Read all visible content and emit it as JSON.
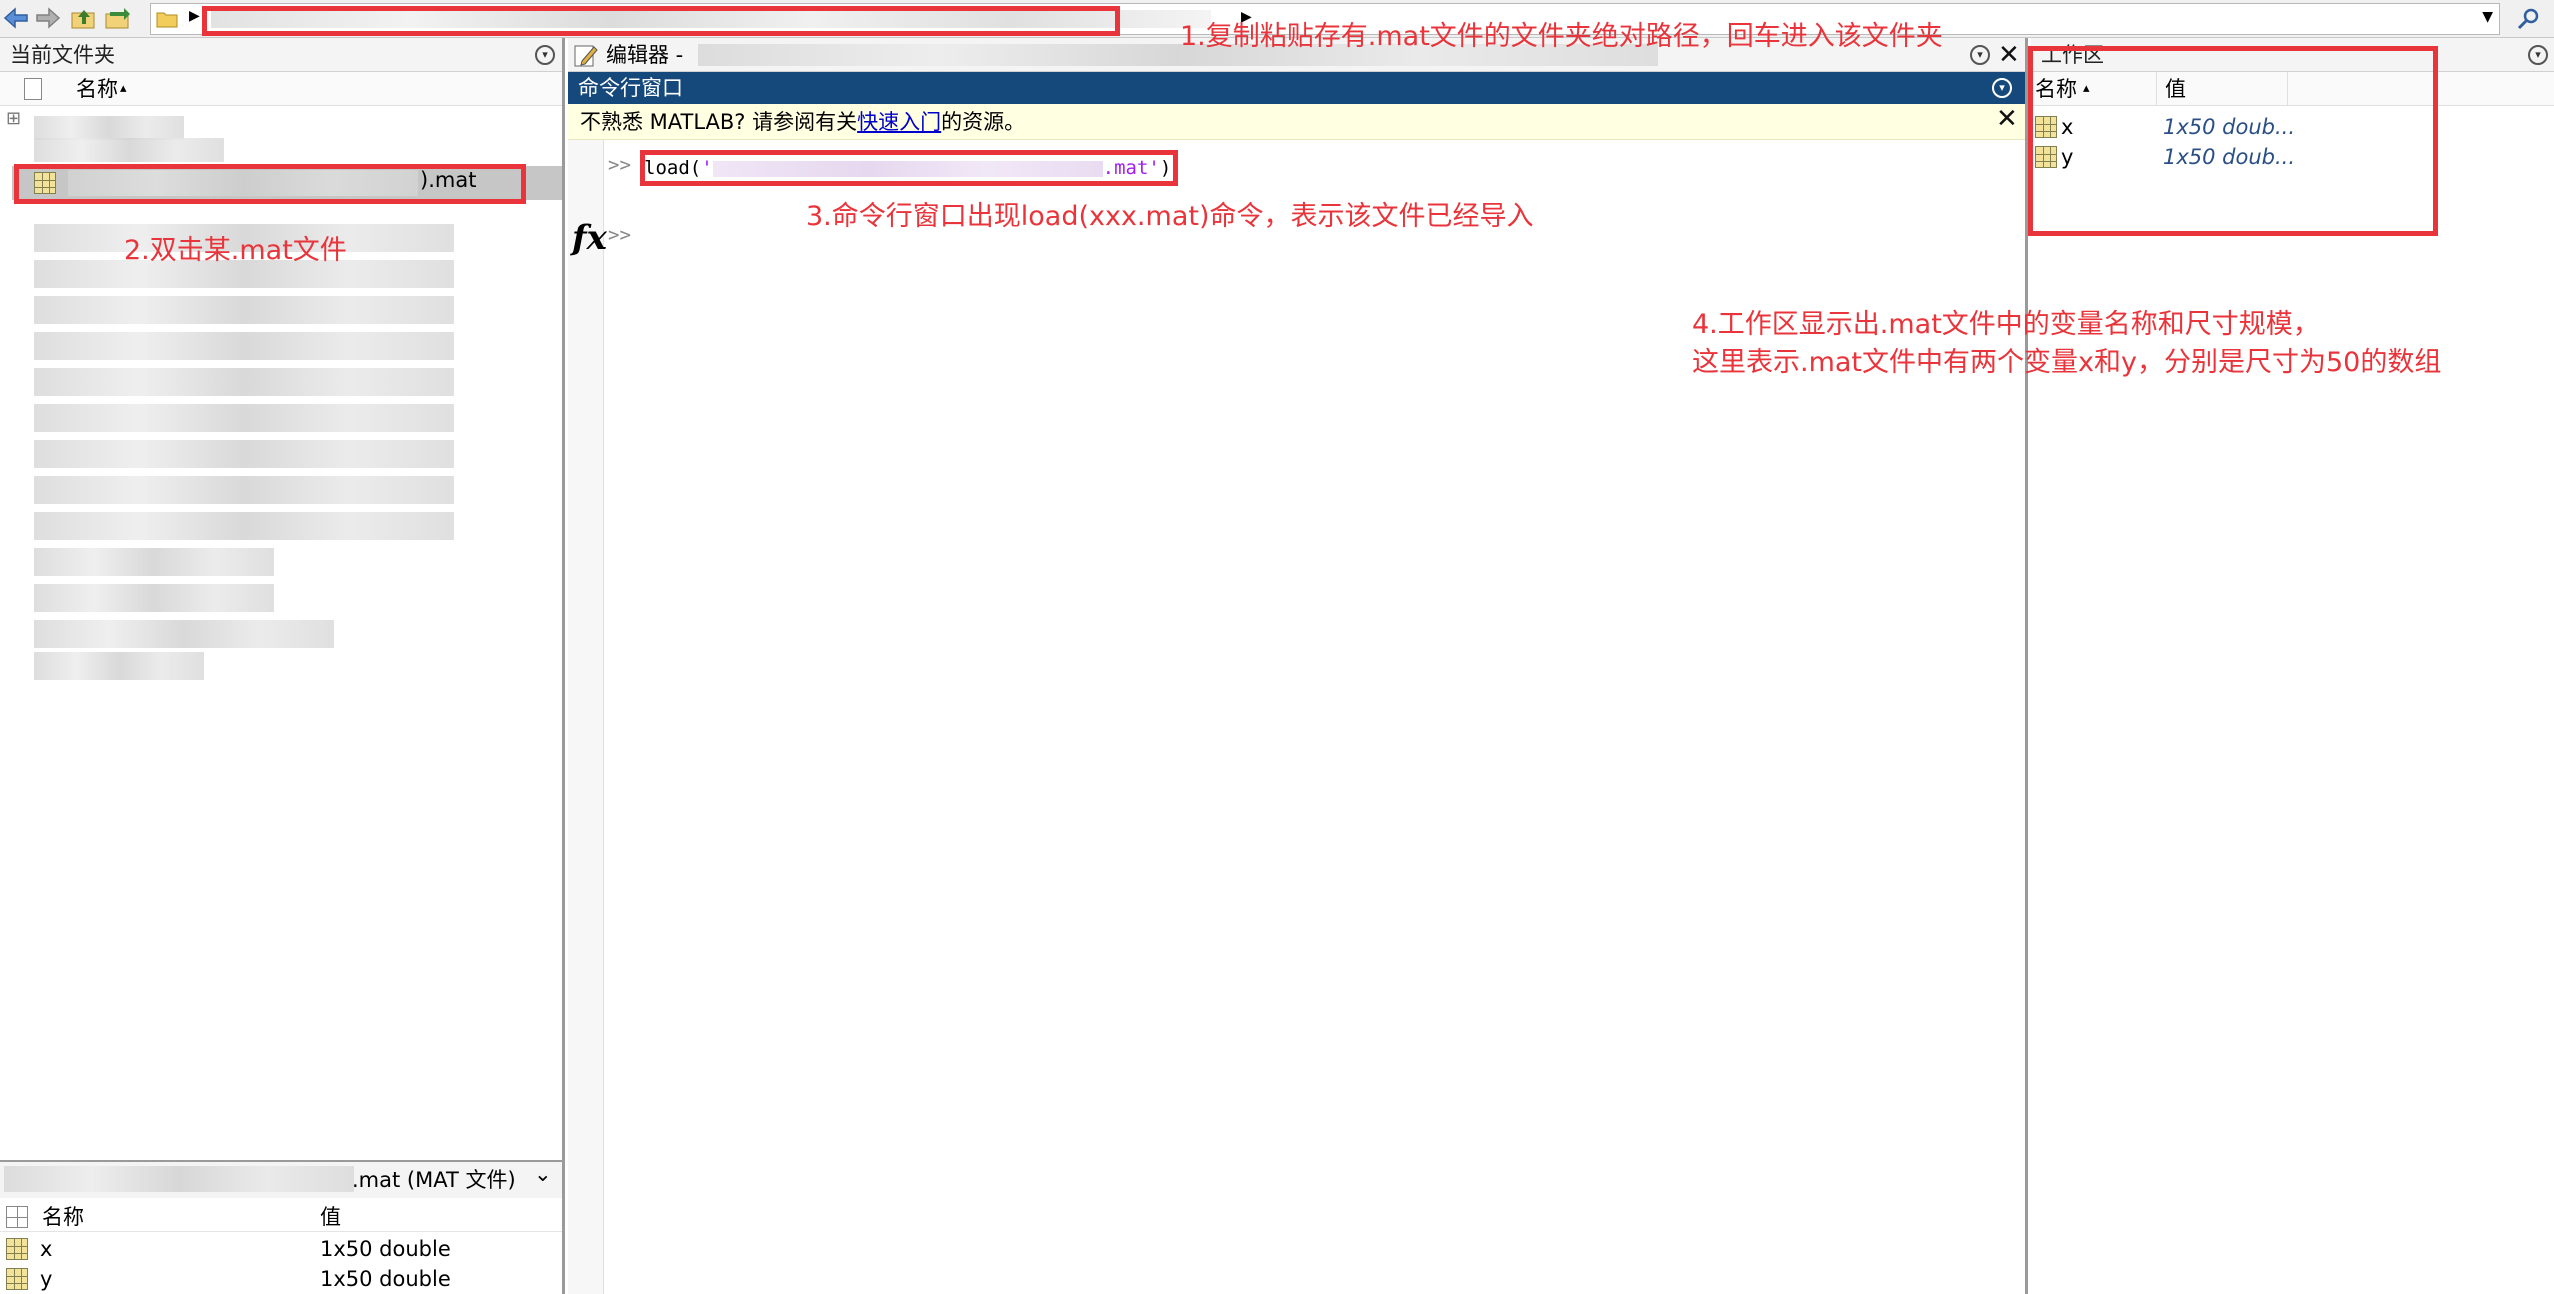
{
  "toolbar": {
    "back_icon": "back-arrow-icon",
    "forward_icon": "forward-arrow-icon",
    "up_icon": "up-folder-icon",
    "browse_icon": "browse-folder-icon",
    "folder_icon": "folder-icon",
    "search_icon": "search-icon"
  },
  "current_folder": {
    "title": "当前文件夹",
    "col_name": "名称",
    "sort_glyph": "▴",
    "expand_glyph": "⊞",
    "selected_file_suffix": ").mat"
  },
  "details": {
    "title_suffix": ".mat  (MAT 文件)",
    "chevron": "⌄",
    "col_name": "名称",
    "col_value": "值",
    "rows": [
      {
        "name": "x",
        "value": "1x50 double"
      },
      {
        "name": "y",
        "value": "1x50 double"
      }
    ]
  },
  "editor": {
    "title": "编辑器 -",
    "close": "✕"
  },
  "command_window": {
    "title": "命令行窗口",
    "notice_prefix": "不熟悉 MATLAB? 请参阅有关",
    "notice_link": "快速入门",
    "notice_suffix": "的资源。",
    "notice_close": "✕",
    "prompt": ">>",
    "command_func": "load(",
    "command_str_start": "'",
    "command_str_end": ".mat'",
    "command_close": ")",
    "fx": "fx"
  },
  "workspace": {
    "title": "工作区",
    "col_name": "名称",
    "col_value": "值",
    "sort_glyph": "▴",
    "rows": [
      {
        "name": "x",
        "value": "1x50 doub..."
      },
      {
        "name": "y",
        "value": "1x50 doub..."
      }
    ]
  },
  "annotations": {
    "step1": "1.复制粘贴存有.mat文件的文件夹绝对路径，回车进入该文件夹",
    "step2": "2.双击某.mat文件",
    "step3": "3.命令行窗口出现load(xxx.mat)命令，表示该文件已经导入",
    "step4_line1": "4.工作区显示出.mat文件中的变量名称和尺寸规模，",
    "step4_line2": "这里表示.mat文件中有两个变量x和y，分别是尺寸为50的数组"
  },
  "colors": {
    "annotation_red": "#e8343a",
    "command_title_bg": "#16497b",
    "notice_bg": "#ffffe1",
    "link_blue": "#0000cc",
    "string_purple": "#a020f0",
    "workspace_value": "#2a4f86"
  }
}
